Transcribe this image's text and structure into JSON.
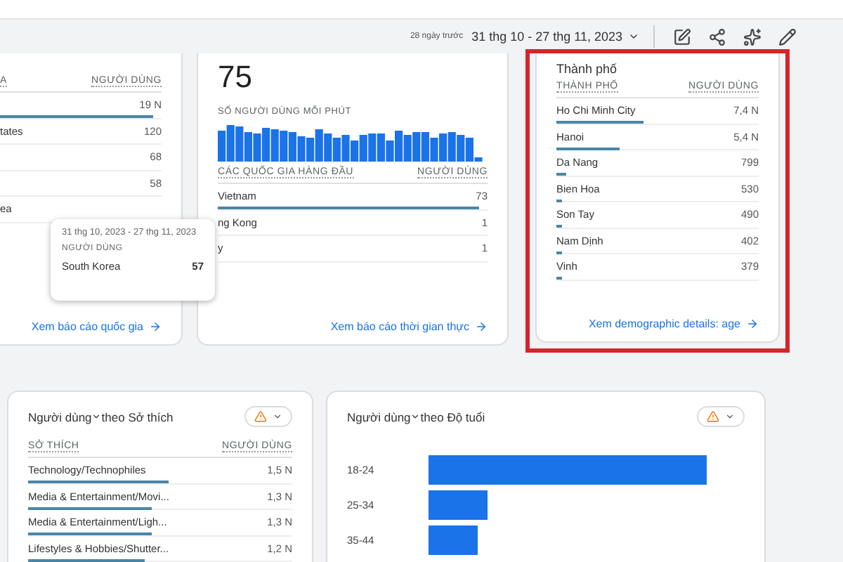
{
  "toolbar": {
    "range_label": "28 ngày trước",
    "date_range": "31 thg 10 - 27 thg 11, 2023"
  },
  "country_card": {
    "header": [
      "A",
      "NGƯỜI DÙNG"
    ],
    "rows": [
      {
        "name": "",
        "value": "19 N",
        "level": 0.95
      },
      {
        "name": "tates",
        "value": "120"
      },
      {
        "name": "",
        "value": "68"
      },
      {
        "name": "",
        "value": "58"
      },
      {
        "name": "ea",
        "value": ""
      }
    ],
    "link": "Xem báo cáo quốc gia"
  },
  "tooltip": {
    "date": "31 thg 10, 2023 - 27 thg 11, 2023",
    "metric": "NGƯỜI DÙNG",
    "name": "South Korea",
    "value": "57"
  },
  "realtime_card": {
    "count": "75",
    "sub": "SỐ NGƯỜI DÙNG MỖI PHÚT",
    "header": [
      "CÁC QUỐC GIA HÀNG ĐẦU",
      "NGƯỜI DÙNG"
    ],
    "rows": [
      {
        "name": "Vietnam",
        "value": "73",
        "level": 0.97
      },
      {
        "name": "ng Kong",
        "value": "1"
      },
      {
        "name": "y",
        "value": "1"
      }
    ],
    "link": "Xem báo cáo thời gian thực"
  },
  "city_card": {
    "title": "Thành phố",
    "header": [
      "THÀNH PHỐ",
      "NGƯỜI DÙNG"
    ],
    "rows": [
      {
        "name": "Ho Chi Minh City",
        "value": "7,4 N",
        "level": 0.43
      },
      {
        "name": "Hanoi",
        "value": "5,4 N",
        "level": 0.31
      },
      {
        "name": "Da Nang",
        "value": "799",
        "level": 0.05
      },
      {
        "name": "Bien Hoa",
        "value": "530",
        "level": 0.03
      },
      {
        "name": "Son Tay",
        "value": "490",
        "level": 0.03
      },
      {
        "name": "Nam Dịnh",
        "value": "402",
        "level": 0.03
      },
      {
        "name": "Vinh",
        "value": "379",
        "level": 0.03
      }
    ],
    "link": "Xem demographic details: age"
  },
  "interest_card": {
    "title_metric": "Người dùng",
    "title_rest": "theo Sở thích",
    "header": [
      "SỞ THÍCH",
      "NGƯỜI DÙNG"
    ],
    "rows": [
      {
        "name": "Technology/Technophiles",
        "value": "1,5 N",
        "level": 0.53
      },
      {
        "name": "Media & Entertainment/Movi...",
        "value": "1,3 N",
        "level": 0.47
      },
      {
        "name": "Media & Entertainment/Ligh...",
        "value": "1,3 N",
        "level": 0.47
      },
      {
        "name": "Lifestyles & Hobbies/Shutter...",
        "value": "1,2 N",
        "level": 0.44
      }
    ]
  },
  "age_card": {
    "title_metric": "Người dùng",
    "title_rest": "theo Độ tuổi",
    "categories": [
      "18-24",
      "25-34",
      "35-44"
    ]
  }
}
